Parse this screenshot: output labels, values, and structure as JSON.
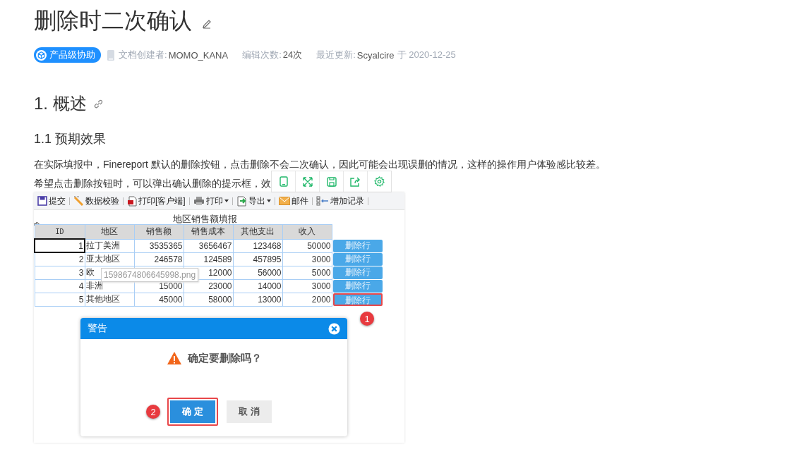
{
  "title": "删除时二次确认",
  "meta": {
    "badge": "产品级协助",
    "creator_label": "文档创建者:",
    "creator": "MOMO_KANA",
    "edits_label": "编辑次数:",
    "edits": "24次",
    "updated_label": "最近更新:",
    "updater": "Scyalcire",
    "updated_suffix": "于 2020-12-25"
  },
  "section": "1. 概述",
  "subsection": "1.1 预期效果",
  "paragraphs": [
    "在实际填报中，Finereport 默认的删除按钮，点击删除不会二次确认，因此可能会出现误删的情况，这样的操作用户体验感比较差。",
    "希望点击删除按钮时，可以弹出确认删除的提示框，效"
  ],
  "image_toolbar": [
    {
      "kind": "tablet"
    },
    {
      "kind": "expand"
    },
    {
      "kind": "save"
    },
    {
      "kind": "share"
    },
    {
      "kind": "settings"
    }
  ],
  "report": {
    "toolbar": [
      {
        "kind": "save",
        "label": "提交",
        "menu": false
      },
      {
        "kind": "check",
        "label": "数据校验",
        "menu": false
      },
      {
        "kind": "pdf",
        "label": "打印[客户端]",
        "menu": false
      },
      {
        "kind": "print",
        "label": "打印",
        "menu": true
      },
      {
        "kind": "export",
        "label": "导出",
        "menu": true
      },
      {
        "kind": "mail",
        "label": "邮件",
        "menu": false
      },
      {
        "kind": "add",
        "label": "增加记录",
        "menu": false
      }
    ],
    "title": "地区销售额填报",
    "columns": [
      "ID",
      "地区",
      "销售额",
      "销售成本",
      "其他支出",
      "收入"
    ],
    "rows": [
      {
        "id": "1",
        "region": "拉丁美洲",
        "sales": "3535365",
        "cost": "3656467",
        "other": "123468",
        "income": "50000",
        "action": "删除行",
        "highlighted": false
      },
      {
        "id": "2",
        "region": "亚太地区",
        "sales": "246578",
        "cost": "124589",
        "other": "457895",
        "income": "3000",
        "action": "删除行",
        "highlighted": false
      },
      {
        "id": "3",
        "region": "欧",
        "cost": "12000",
        "other": "56000",
        "income": "5000",
        "action": "删除行",
        "highlighted": false
      },
      {
        "id": "4",
        "region": "非洲",
        "sales": "15000",
        "cost": "23000",
        "other": "14000",
        "income": "3000",
        "action": "删除行",
        "highlighted": false
      },
      {
        "id": "5",
        "region": "其他地区",
        "sales": "45000",
        "cost": "58000",
        "other": "13000",
        "income": "2000",
        "action": "删除行",
        "highlighted": true
      }
    ],
    "tooltip": "1598674806645998.png",
    "step_badges": [
      "1",
      "2"
    ],
    "dialog": {
      "title": "警告",
      "message": "确定要删除吗？",
      "buttons": [
        {
          "label": "确 定",
          "kind": "primary",
          "highlighted": true
        },
        {
          "label": "取 消",
          "kind": "secondary",
          "highlighted": false
        }
      ]
    }
  }
}
